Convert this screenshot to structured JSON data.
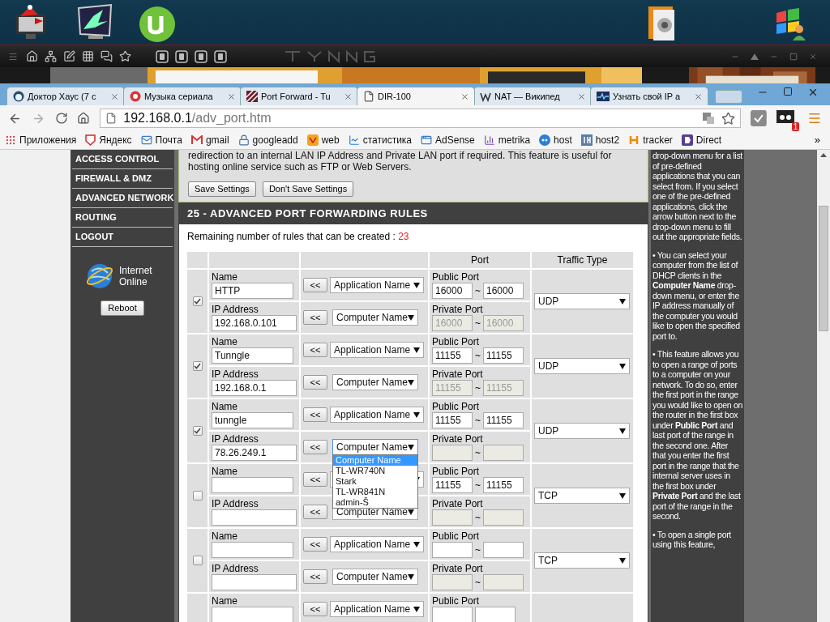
{
  "browser": {
    "tabs": [
      {
        "label": "Доктор Хаус (7 с",
        "selected": false
      },
      {
        "label": "Музыка сериала",
        "selected": false
      },
      {
        "label": "Port Forward - Tu",
        "selected": false
      },
      {
        "label": "DIR-100",
        "selected": true
      },
      {
        "label": "NAT — Википед",
        "selected": false
      },
      {
        "label": "Узнать свой IP а",
        "selected": false
      }
    ],
    "url_host": "192.168.0.1",
    "url_path": "/adv_port.htm",
    "extension_badge": "1",
    "bookmarks": [
      "Приложения",
      "Яндекс",
      "Почта",
      "gmail",
      "googleadd",
      "web",
      "статистика",
      "AdSense",
      "metrika",
      "host",
      "host2",
      "tracker",
      "Direct"
    ],
    "bookmarks_more": "»"
  },
  "sidebar": {
    "items": [
      "ACCESS CONTROL",
      "FIREWALL & DMZ",
      "ADVANCED NETWORK",
      "ROUTING",
      "LOGOUT"
    ],
    "status": "Internet Online",
    "reboot": "Reboot"
  },
  "intro": {
    "text": "redirection to an internal LAN IP Address and Private LAN port if required. This feature is useful for hosting online service such as FTP or Web Servers.",
    "buttons": [
      "Save Settings",
      "Don't Save Settings"
    ]
  },
  "rules_section": {
    "title": "25 - ADVANCED PORT FORWARDING RULES",
    "remaining_label": "Remaining number of rules that can be created :",
    "remaining": "23",
    "columns": {
      "port": "Port",
      "traffic": "Traffic Type"
    },
    "fill_button": "<<",
    "rules": [
      {
        "checked": true,
        "name_label": "Name",
        "name": "HTTP",
        "app_select": "Application Name",
        "public_label": "Public Port",
        "public_from": "16000",
        "public_to": "16000",
        "ip_label": "IP Address",
        "ip": "192.168.0.101",
        "computer_select": "Computer Name",
        "private_label": "Private Port",
        "private_from": "16000",
        "private_to": "16000",
        "traffic": "UDP",
        "tilde": "~"
      },
      {
        "checked": true,
        "name_label": "Name",
        "name": "Tunngle",
        "app_select": "Application Name",
        "public_label": "Public Port",
        "public_from": "11155",
        "public_to": "11155",
        "ip_label": "IP Address",
        "ip": "192.168.0.1",
        "computer_select": "Computer Name",
        "private_label": "Private Port",
        "private_from": "11155",
        "private_to": "11155",
        "traffic": "UDP",
        "tilde": "~"
      },
      {
        "checked": true,
        "name_label": "Name",
        "name": "tunngle",
        "app_select": "Application Name",
        "public_label": "Public Port",
        "public_from": "11155",
        "public_to": "11155",
        "ip_label": "IP Address",
        "ip": "78.26.249.1",
        "computer_select": "Computer Name",
        "private_label": "Private Port",
        "traffic": "UDP",
        "tilde": "~",
        "dropdown": [
          {
            "label": "Computer Name",
            "selected": true
          },
          {
            "label": "TL-WR740N",
            "selected": false
          },
          {
            "label": "Stark",
            "selected": false
          },
          {
            "label": "TL-WR841N",
            "selected": false
          },
          {
            "label": "admin-Š",
            "selected": false
          }
        ]
      },
      {
        "checked": false,
        "name_label": "Name",
        "public_label": "Public Port",
        "public_from": "11155",
        "public_to": "11155",
        "ip_label": "IP Address",
        "computer_select": "Computer Name",
        "private_label": "Private Port",
        "traffic": "TCP",
        "tilde": "~"
      },
      {
        "checked": false,
        "name_label": "Name",
        "app_select": "Application Name",
        "public_label": "Public Port",
        "ip_label": "IP Address",
        "computer_select": "Computer Name",
        "private_label": "Private Port",
        "traffic": "TCP",
        "tilde": "~"
      },
      {
        "name_label": "Name",
        "app_select": "Application Name",
        "public_label": "Public Port"
      }
    ]
  },
  "help": {
    "paragraphs": [
      "drop-down menu for a list of pre-defined applications that you can select from. If you select one of the pre-defined applications, click the arrow button next to the drop-down menu to fill out the appropriate fields.",
      "• You can select your computer from the list of DHCP clients in the **Computer Name** drop-down menu, or enter the IP address manually of the computer you would like to open the specified port to.",
      "• This feature allows you to open a range of ports to a computer on your network. To do so, enter the first port in the range you would like to open on the router in the first box under **Public Port** and last port of the range in the second one. After that you enter the first port in the range that the internal server uses in the first box under **Private Port** and the last port of the range in the second.",
      "• To open a single port using this feature,"
    ]
  }
}
